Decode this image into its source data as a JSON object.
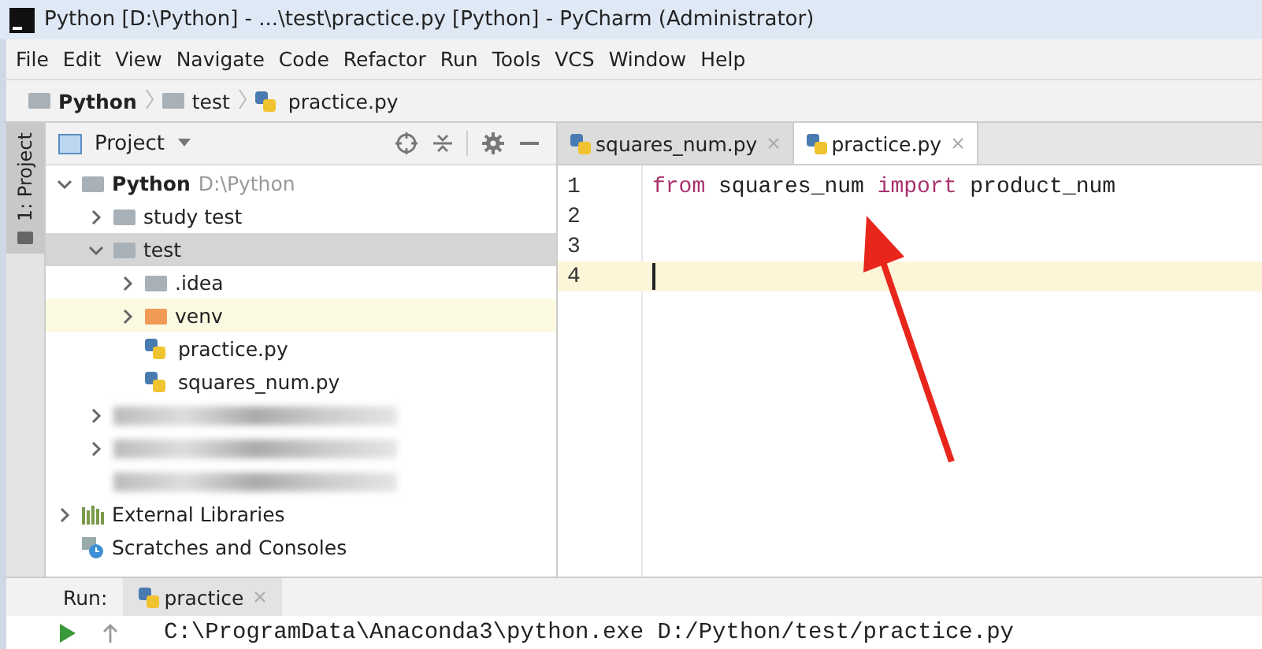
{
  "window": {
    "title": "Python [D:\\Python] - ...\\test\\practice.py [Python] - PyCharm (Administrator)"
  },
  "menu": [
    "File",
    "Edit",
    "View",
    "Navigate",
    "Code",
    "Refactor",
    "Run",
    "Tools",
    "VCS",
    "Window",
    "Help"
  ],
  "breadcrumb": [
    {
      "label": "Python",
      "kind": "folder"
    },
    {
      "label": "test",
      "kind": "folder"
    },
    {
      "label": "practice.py",
      "kind": "python"
    }
  ],
  "side_tab": {
    "label": "1: Project"
  },
  "project_panel": {
    "title": "Project"
  },
  "tree": [
    {
      "label": "Python",
      "path": "D:\\Python",
      "kind": "root",
      "expanded": true,
      "selected": false,
      "children": [
        {
          "label": "study test",
          "kind": "folder",
          "expanded": false,
          "selected": false
        },
        {
          "label": "test",
          "kind": "folder",
          "expanded": true,
          "selected": true,
          "children": [
            {
              "label": ".idea",
              "kind": "folder",
              "expanded": false,
              "selected": false
            },
            {
              "label": "venv",
              "kind": "excluded",
              "expanded": false,
              "selected": false
            },
            {
              "label": "practice.py",
              "kind": "python",
              "selected": false
            },
            {
              "label": "squares_num.py",
              "kind": "python",
              "selected": false
            }
          ]
        },
        {
          "kind": "blurred",
          "expanded": false,
          "selected": false
        },
        {
          "kind": "blurred",
          "expanded": false,
          "selected": false
        },
        {
          "kind": "blurred",
          "selected": false
        }
      ]
    },
    {
      "label": "External Libraries",
      "kind": "libraries",
      "expanded": false,
      "selected": false
    },
    {
      "label": "Scratches and Consoles",
      "kind": "scratches",
      "selected": false
    }
  ],
  "editor_tabs": [
    {
      "label": "squares_num.py",
      "selected": false
    },
    {
      "label": "practice.py",
      "selected": true
    }
  ],
  "code_lines": [
    {
      "number": "1",
      "current": false,
      "tokens": [
        {
          "text": "from",
          "kind": "keyword"
        },
        {
          "text": " squares_num ",
          "kind": "ident"
        },
        {
          "text": "import",
          "kind": "keyword"
        },
        {
          "text": " product_num",
          "kind": "ident"
        }
      ]
    },
    {
      "number": "2",
      "current": false
    },
    {
      "number": "3",
      "current": false
    },
    {
      "number": "4",
      "current": true
    }
  ],
  "run_panel": {
    "label": "Run:",
    "tab": "practice",
    "console": "C:\\ProgramData\\Anaconda3\\python.exe D:/Python/test/practice.py"
  }
}
